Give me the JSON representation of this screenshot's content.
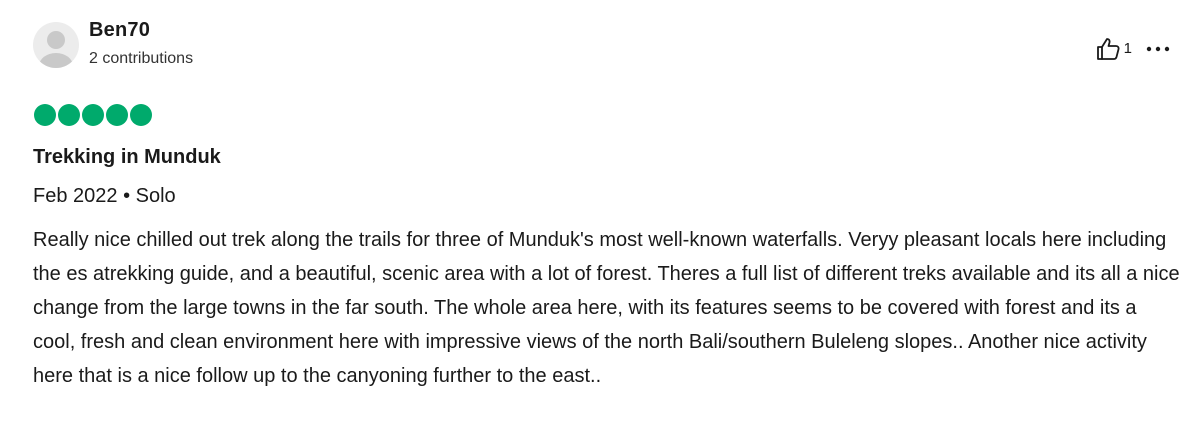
{
  "reviewer": {
    "name": "Ben70",
    "contributions": "2 contributions"
  },
  "actions": {
    "helpful_count": "1"
  },
  "rating": {
    "value": 5,
    "max": 5,
    "color": "#00aa6c"
  },
  "review": {
    "title": "Trekking in Munduk",
    "date": "Feb 2022",
    "separator": " • ",
    "trip_type": "Solo",
    "body": "Really nice chilled out trek along the trails for three of Munduk's most well-known waterfalls. Veryy pleasant locals here including the es atrekking guide, and a beautiful, scenic area with a lot of forest. Theres a full list of different treks available and its all a nice change from the large towns in the far south. The whole area here, with its features seems to be covered with forest and its a cool, fresh and clean environment here with impressive views of the north Bali/southern Buleleng slopes.. Another nice activity here that is a nice follow up to the canyoning further to the east.."
  },
  "icons": {
    "avatar": "avatar-placeholder-icon",
    "helpful": "thumbs-up-icon",
    "more": "ellipsis-icon"
  }
}
